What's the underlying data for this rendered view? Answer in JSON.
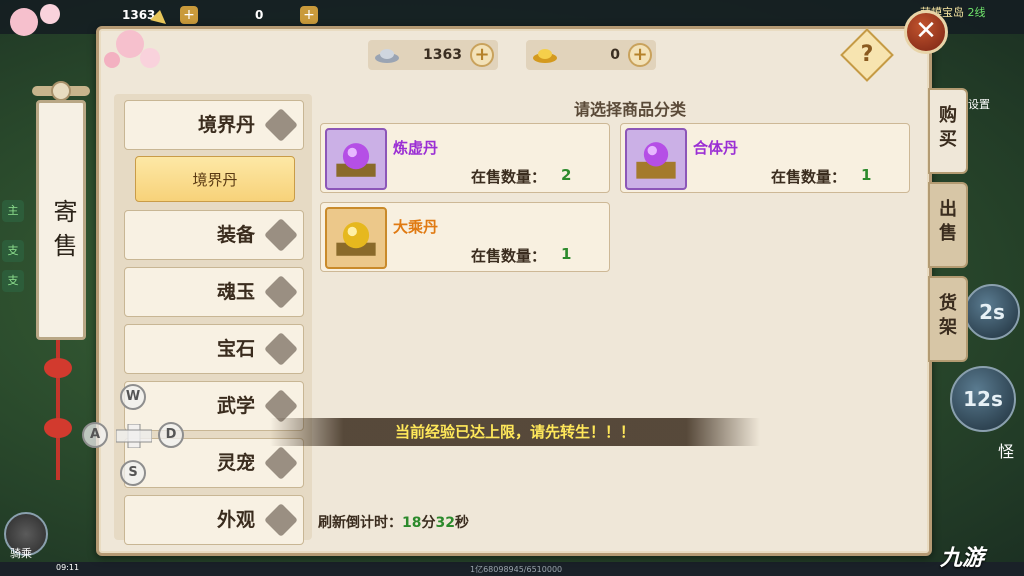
{
  "hud": {
    "silver": "1363",
    "gold": "0",
    "map_name": "萌蟆宝岛",
    "map_line": "2线",
    "skill_1": "2s",
    "skill_2": "12s",
    "side_labels": [
      "主",
      "支",
      "支",
      "主"
    ],
    "mount_label": "骑乘",
    "time": "09:11",
    "exp_text": "1亿68098945/6510000",
    "side_text_1": "设置",
    "side_text_2": "怪"
  },
  "panel": {
    "title": "寄售",
    "currency": {
      "silver_value": "1363",
      "gold_value": "0",
      "plus": "+"
    },
    "help_label": "?",
    "close_label": "✕",
    "prompt": "请选择商品分类",
    "categories": [
      {
        "label": "境界丹",
        "expanded": true
      },
      {
        "label": "装备",
        "expanded": false
      },
      {
        "label": "魂玉",
        "expanded": false
      },
      {
        "label": "宝石",
        "expanded": false
      },
      {
        "label": "武学",
        "expanded": false
      },
      {
        "label": "灵宠",
        "expanded": false
      },
      {
        "label": "外观",
        "expanded": false
      }
    ],
    "subcategory": "境界丹",
    "items": [
      {
        "name": "炼虚丹",
        "qty_label": "在售数量：",
        "qty": "2",
        "color": "#9b2fd4"
      },
      {
        "name": "合体丹",
        "qty_label": "在售数量：",
        "qty": "1",
        "color": "#9b2fd4"
      },
      {
        "name": "大乘丹",
        "qty_label": "在售数量：",
        "qty": "1",
        "color": "#e07a12"
      }
    ],
    "refresh": {
      "label": "刷新倒计时：",
      "minutes": "18",
      "min_unit": "分",
      "seconds": "32",
      "sec_unit": "秒"
    },
    "tabs": [
      "购买",
      "出售",
      "货架"
    ],
    "active_tab": "购买"
  },
  "notice": "当前经验已达上限，请先转生！！！",
  "joystick": {
    "w": "W",
    "a": "A",
    "s": "S",
    "d": "D"
  },
  "watermark": "九游",
  "colors": {
    "panel_bg": "#efe7d8",
    "accent_gold": "#c99a3b",
    "qty_green": "#2c8a2c",
    "notice_yellow": "#ffe85a"
  }
}
